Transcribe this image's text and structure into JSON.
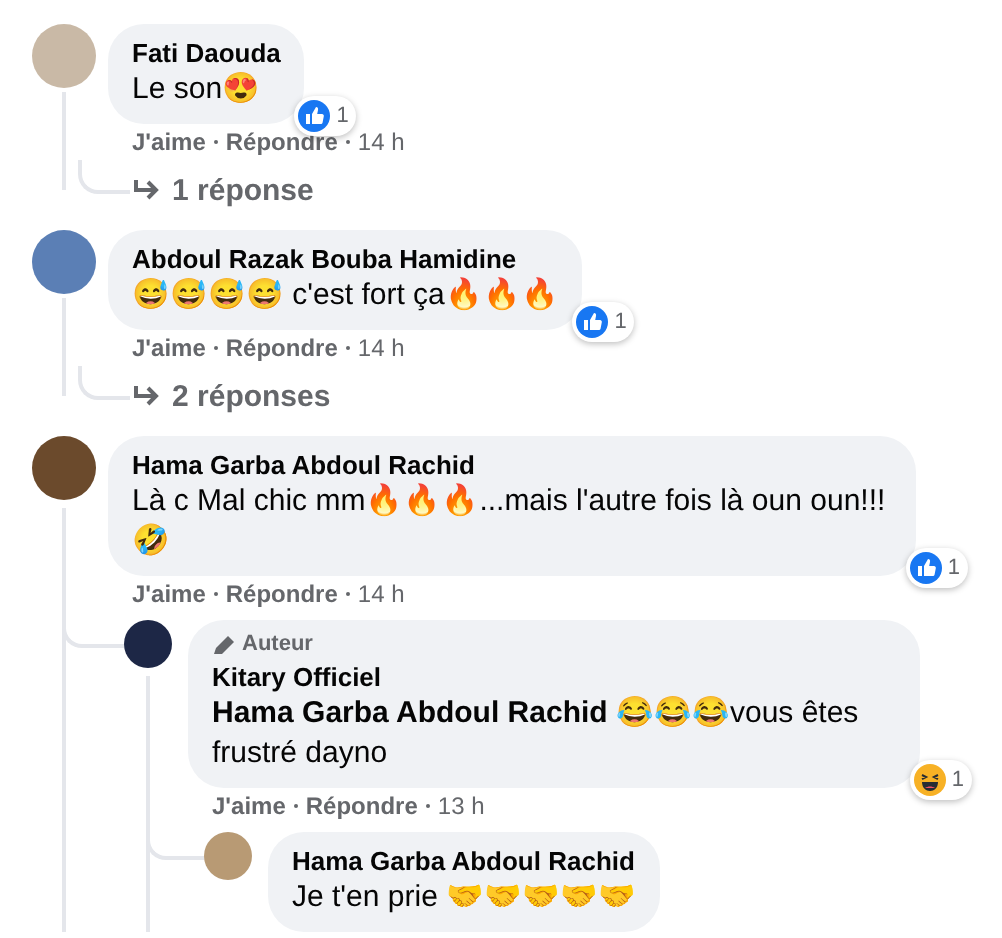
{
  "comments": [
    {
      "author": "Fati Daouda",
      "text": "Le son😍",
      "reaction": {
        "kind": "like",
        "count": "1"
      },
      "actions": {
        "like": "J'aime",
        "reply": "Répondre",
        "time": "14 h"
      },
      "replies_link": "1 réponse"
    },
    {
      "author": "Abdoul Razak Bouba Hamidine",
      "text": "😅😅😅😅 c'est fort ça🔥🔥🔥",
      "reaction": {
        "kind": "like",
        "count": "1"
      },
      "actions": {
        "like": "J'aime",
        "reply": "Répondre",
        "time": "14 h"
      },
      "replies_link": "2 réponses"
    },
    {
      "author": "Hama Garba Abdoul Rachid",
      "text": "Là c Mal chic mm🔥🔥🔥...mais l'autre fois là oun oun!!! 🤣",
      "reaction": {
        "kind": "like",
        "count": "1"
      },
      "actions": {
        "like": "J'aime",
        "reply": "Répondre",
        "time": "14 h"
      },
      "replies": [
        {
          "badge": "Auteur",
          "author": "Kitary Officiel",
          "text": "**Hama Garba Abdoul Rachid** 😂😂😂vous êtes frustré dayno",
          "reaction": {
            "kind": "haha",
            "count": "1"
          },
          "actions": {
            "like": "J'aime",
            "reply": "Répondre",
            "time": "13 h"
          },
          "replies": [
            {
              "author": "Hama Garba Abdoul Rachid",
              "text": "Je t'en prie 🤝🤝🤝🤝🤝"
            }
          ]
        }
      ]
    }
  ]
}
